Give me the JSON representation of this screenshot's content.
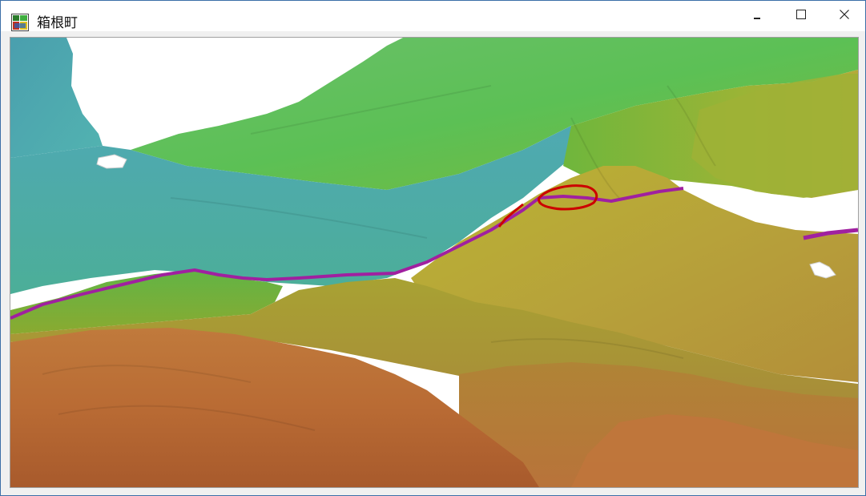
{
  "window": {
    "title": "箱根町",
    "app_icon": "map-app-icon",
    "controls": {
      "minimize_icon": "minimize-icon",
      "maximize_icon": "maximize-icon",
      "close_icon": "close-icon"
    }
  },
  "viewport": {
    "content": "3d-terrain-view",
    "colors": {
      "water": "#ffffff",
      "low_teal": "#4aa8b0",
      "mid_green": "#5fb84a",
      "yellow_green": "#a9b83a",
      "olive": "#b39a3a",
      "brown": "#b86a33",
      "road": "#a020a0",
      "marker": "#cc0000"
    }
  }
}
